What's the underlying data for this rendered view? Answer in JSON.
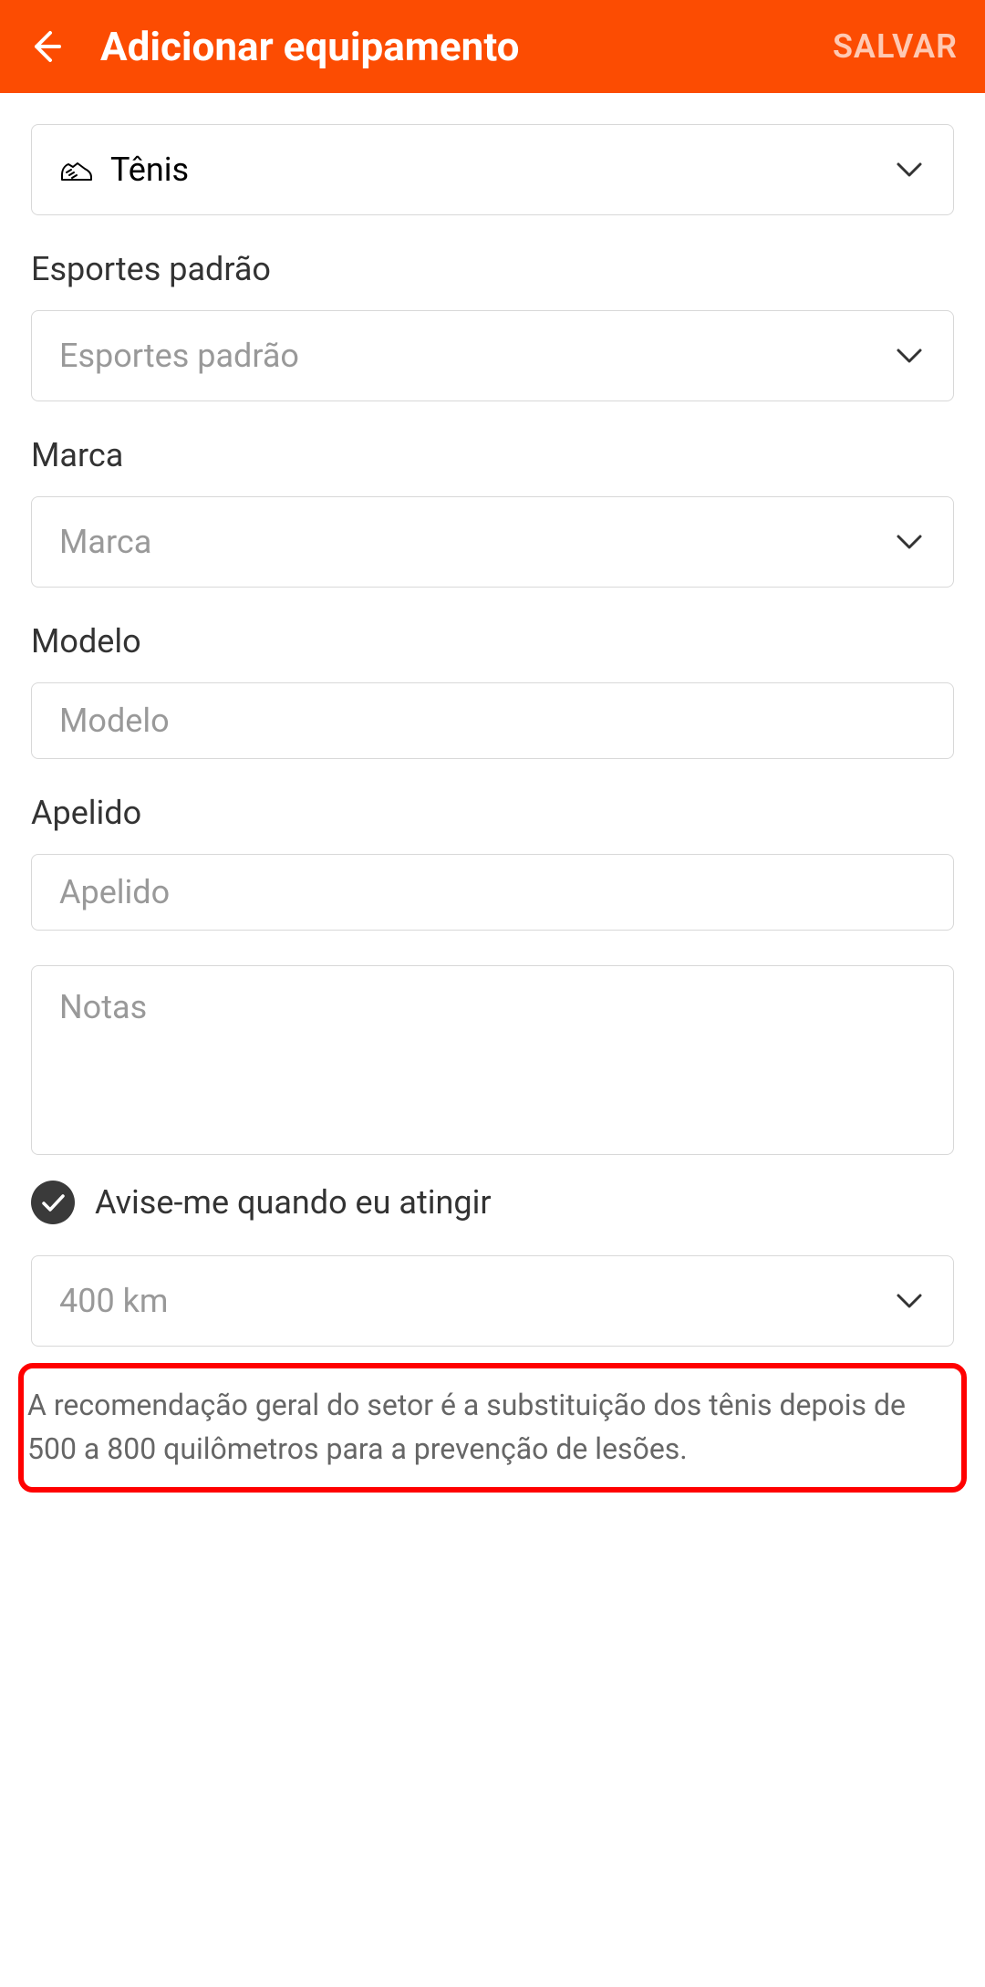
{
  "header": {
    "title": "Adicionar equipamento",
    "save_label": "SALVAR"
  },
  "equipment_type": {
    "selected": "Tênis"
  },
  "default_sports": {
    "label": "Esportes padrão",
    "placeholder": "Esportes padrão"
  },
  "brand": {
    "label": "Marca",
    "placeholder": "Marca"
  },
  "model": {
    "label": "Modelo",
    "placeholder": "Modelo"
  },
  "nickname": {
    "label": "Apelido",
    "placeholder": "Apelido"
  },
  "notes": {
    "placeholder": "Notas"
  },
  "notify": {
    "label": "Avise-me quando eu atingir",
    "checked": true
  },
  "distance": {
    "value": "400 km"
  },
  "recommendation": {
    "text": "A recomendação geral do setor é a substituição dos tênis depois de 500 a 800 quilômetros para a prevenção de lesões."
  }
}
